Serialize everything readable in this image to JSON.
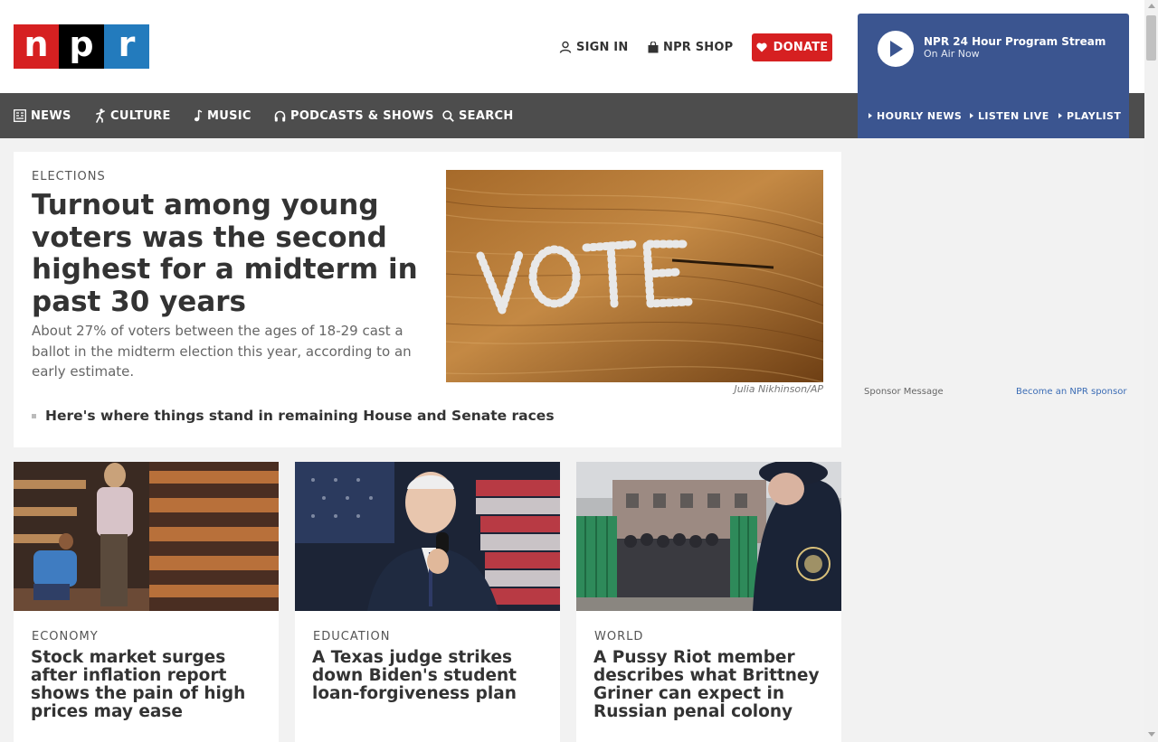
{
  "header": {
    "logo_letters": [
      "n",
      "p",
      "r"
    ],
    "sign_in": "SIGN IN",
    "shop": "NPR SHOP",
    "donate": "DONATE"
  },
  "player": {
    "title": "NPR 24 Hour Program Stream",
    "subtitle": "On Air Now",
    "links": [
      "HOURLY NEWS",
      "LISTEN LIVE",
      "PLAYLIST"
    ]
  },
  "nav": {
    "items": [
      "NEWS",
      "CULTURE",
      "MUSIC",
      "PODCASTS & SHOWS",
      "SEARCH"
    ]
  },
  "hero": {
    "slug": "ELECTIONS",
    "title": "Turnout among young voters was the second highest for a midterm in past 30 years",
    "teaser": "About 27% of voters between the ages of 18-29 cast a ballot in the midterm election this year, according to an early estimate.",
    "image_credit": "Julia Nikhinson/AP",
    "related": "Here's where things stand in remaining House and Senate races"
  },
  "sponsor": {
    "label": "Sponsor Message",
    "link": "Become an NPR sponsor"
  },
  "stories": [
    {
      "slug": "ECONOMY",
      "title": "Stock market surges after inflation report shows the pain of high prices may ease"
    },
    {
      "slug": "EDUCATION",
      "title": "A Texas judge strikes down Biden's student loan-forgiveness plan"
    },
    {
      "slug": "WORLD",
      "title": "A Pussy Riot member describes what Brittney Griner can expect in Russian penal colony"
    }
  ],
  "colors": {
    "npr_red": "#d62021",
    "npr_blue": "#237bbd",
    "player_blue": "#3b5590",
    "nav_gray": "#4d4d4d"
  }
}
